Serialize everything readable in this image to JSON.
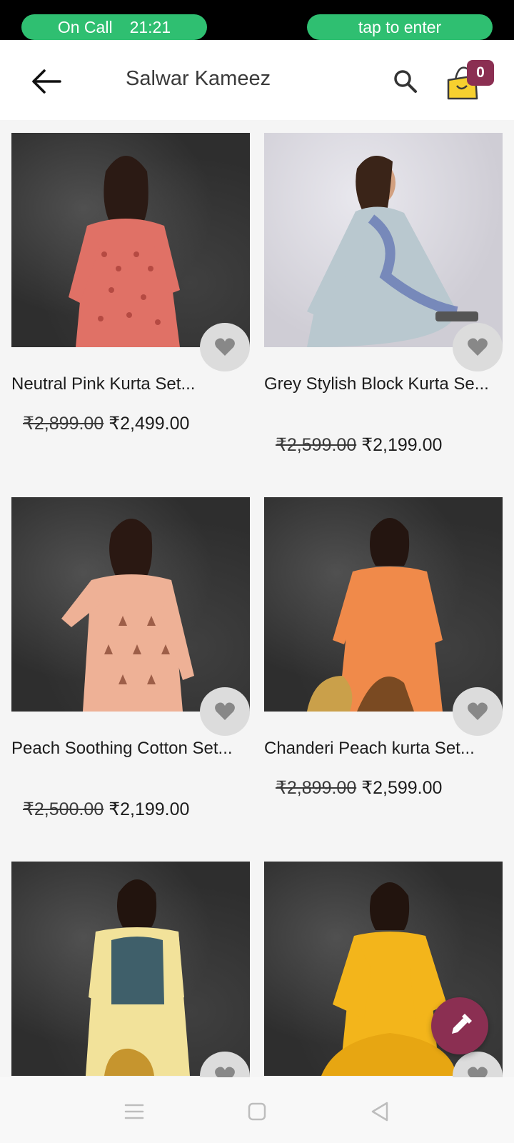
{
  "status_bar": {
    "call_label": "On Call",
    "call_time": "21:21",
    "tap_label": "tap to enter",
    "pill_color": "#2fbf71"
  },
  "header": {
    "title": "Salwar Kameez",
    "back_icon": "arrow-left-icon",
    "search_icon": "search-icon",
    "cart_icon": "shopping-bag-icon",
    "cart_count": "0",
    "accent": "#8b2f52"
  },
  "products": [
    {
      "name": "Neutral Pink Kurta Set...",
      "old_price": "₹2,899.00",
      "price": "₹2,499.00"
    },
    {
      "name": "Grey Stylish Block Kurta Se...",
      "old_price": "₹2,599.00",
      "price": "₹2,199.00"
    },
    {
      "name": "Peach Soothing Cotton Set...",
      "old_price": "₹2,500.00",
      "price": "₹2,199.00"
    },
    {
      "name": "Chanderi Peach kurta Set...",
      "old_price": "₹2,899.00",
      "price": "₹2,599.00"
    },
    {
      "name": "",
      "old_price": "",
      "price": ""
    },
    {
      "name": "",
      "old_price": "",
      "price": ""
    }
  ],
  "fab": {
    "icon": "pencil-icon"
  },
  "nav": {
    "icons": [
      "menu-icon",
      "home-square-icon",
      "back-triangle-icon"
    ]
  }
}
